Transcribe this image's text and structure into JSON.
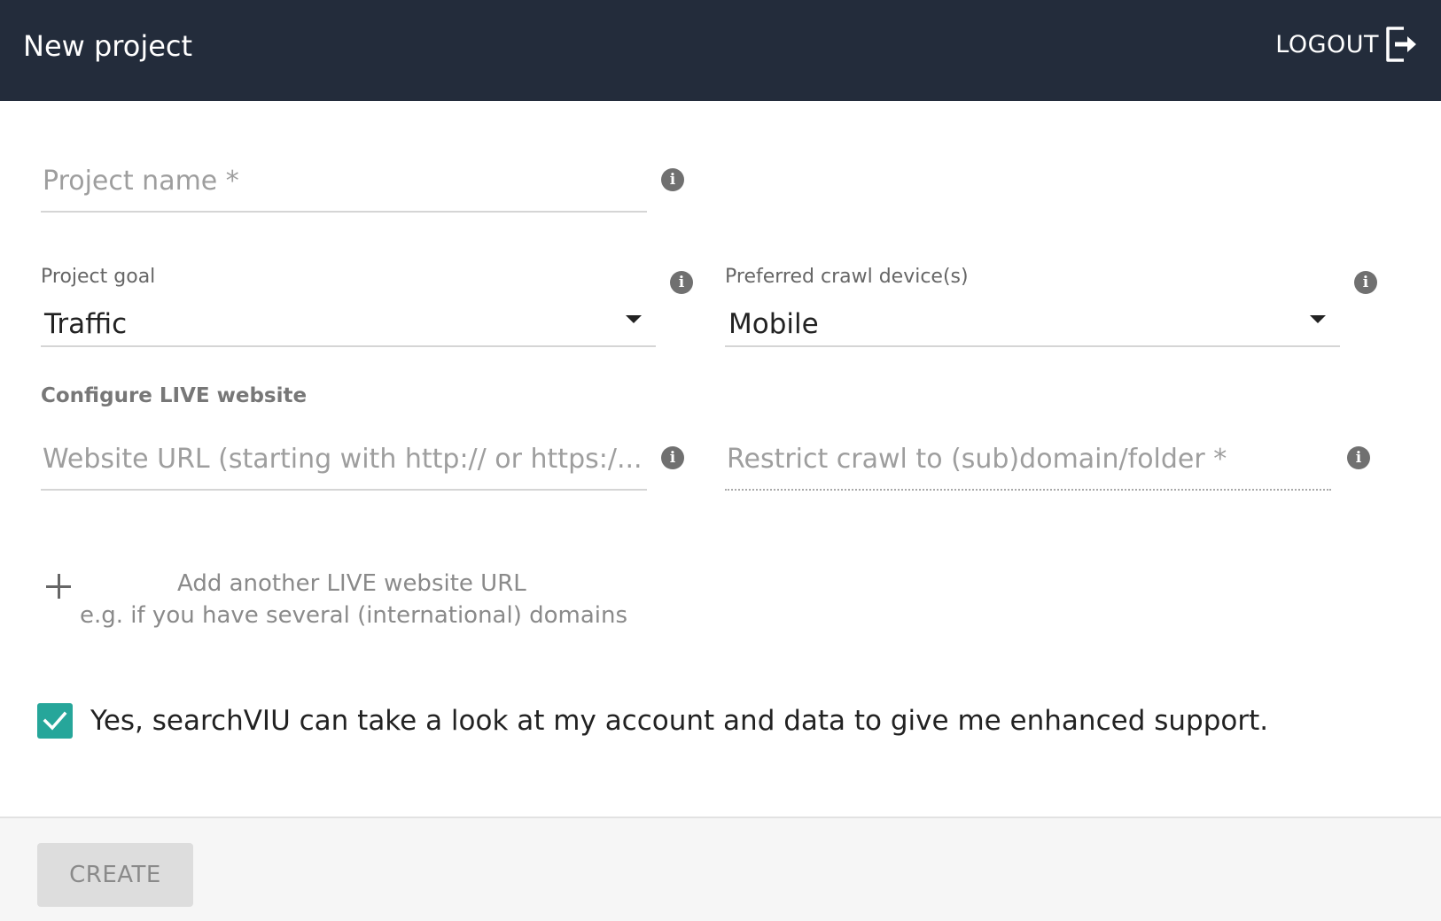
{
  "header": {
    "title": "New project",
    "logout_label": "LOGOUT"
  },
  "form": {
    "project_name": {
      "placeholder": "Project name *",
      "value": ""
    },
    "project_goal": {
      "label": "Project goal",
      "selected": "Traffic"
    },
    "crawl_device": {
      "label": "Preferred crawl device(s)",
      "selected": "Mobile"
    },
    "live_section_title": "Configure LIVE website",
    "website_url": {
      "placeholder": "Website URL (starting with http:// or https:/...",
      "value": ""
    },
    "restrict_crawl": {
      "placeholder": "Restrict crawl to (sub)domain/folder *",
      "value": ""
    },
    "add_url": {
      "label": "Add another LIVE website URL",
      "hint": "e.g. if you have several (international) domains"
    },
    "consent": {
      "checked": true,
      "label": "Yes, searchVIU can take a look at my account and data to give me enhanced support."
    }
  },
  "footer": {
    "create_label": "CREATE",
    "create_disabled": true
  },
  "colors": {
    "header_bg": "#232c3b",
    "checkbox_accent": "#26a69a",
    "info_icon": "#707070"
  },
  "icons": {
    "info": "info-icon",
    "logout": "logout-icon",
    "plus": "plus-icon",
    "check": "check-icon",
    "dropdown": "caret-down-icon"
  }
}
